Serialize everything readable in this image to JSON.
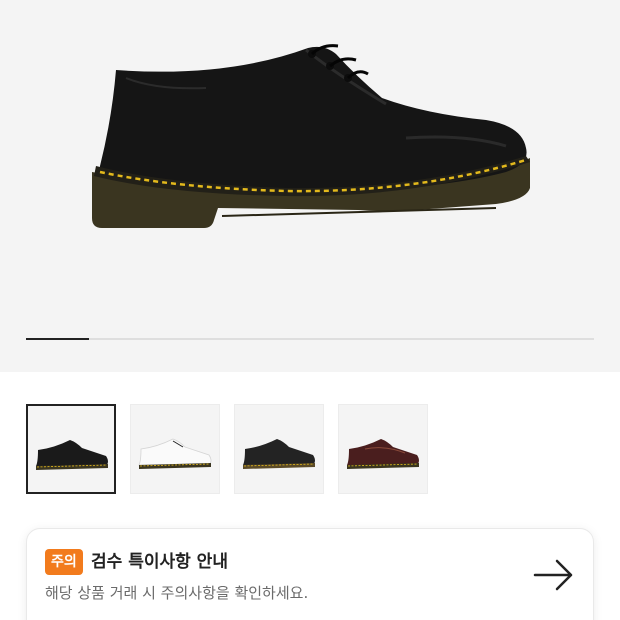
{
  "gallery": {
    "current_index": 1,
    "total_images": 9,
    "thumbnails": [
      {
        "name": "thumb-black-smooth",
        "color": "#1a1a1a",
        "selected": true
      },
      {
        "name": "thumb-white-smooth",
        "color": "#f7f7f7",
        "selected": false
      },
      {
        "name": "thumb-black-smooth-alt",
        "color": "#232323",
        "selected": false
      },
      {
        "name": "thumb-cherry-red",
        "color": "#4a1e1e",
        "selected": false
      }
    ]
  },
  "notice": {
    "badge": "주의",
    "title": "검수 특이사항 안내",
    "description": "해당 상품 거래 시 주의사항을 확인하세요.",
    "arrow_icon": "arrow-right-icon",
    "badge_color": "#f27b1d"
  },
  "colors": {
    "hero_background": "#f4f4f4",
    "stitching": "#e3b91c",
    "sole": "#3a3520"
  }
}
